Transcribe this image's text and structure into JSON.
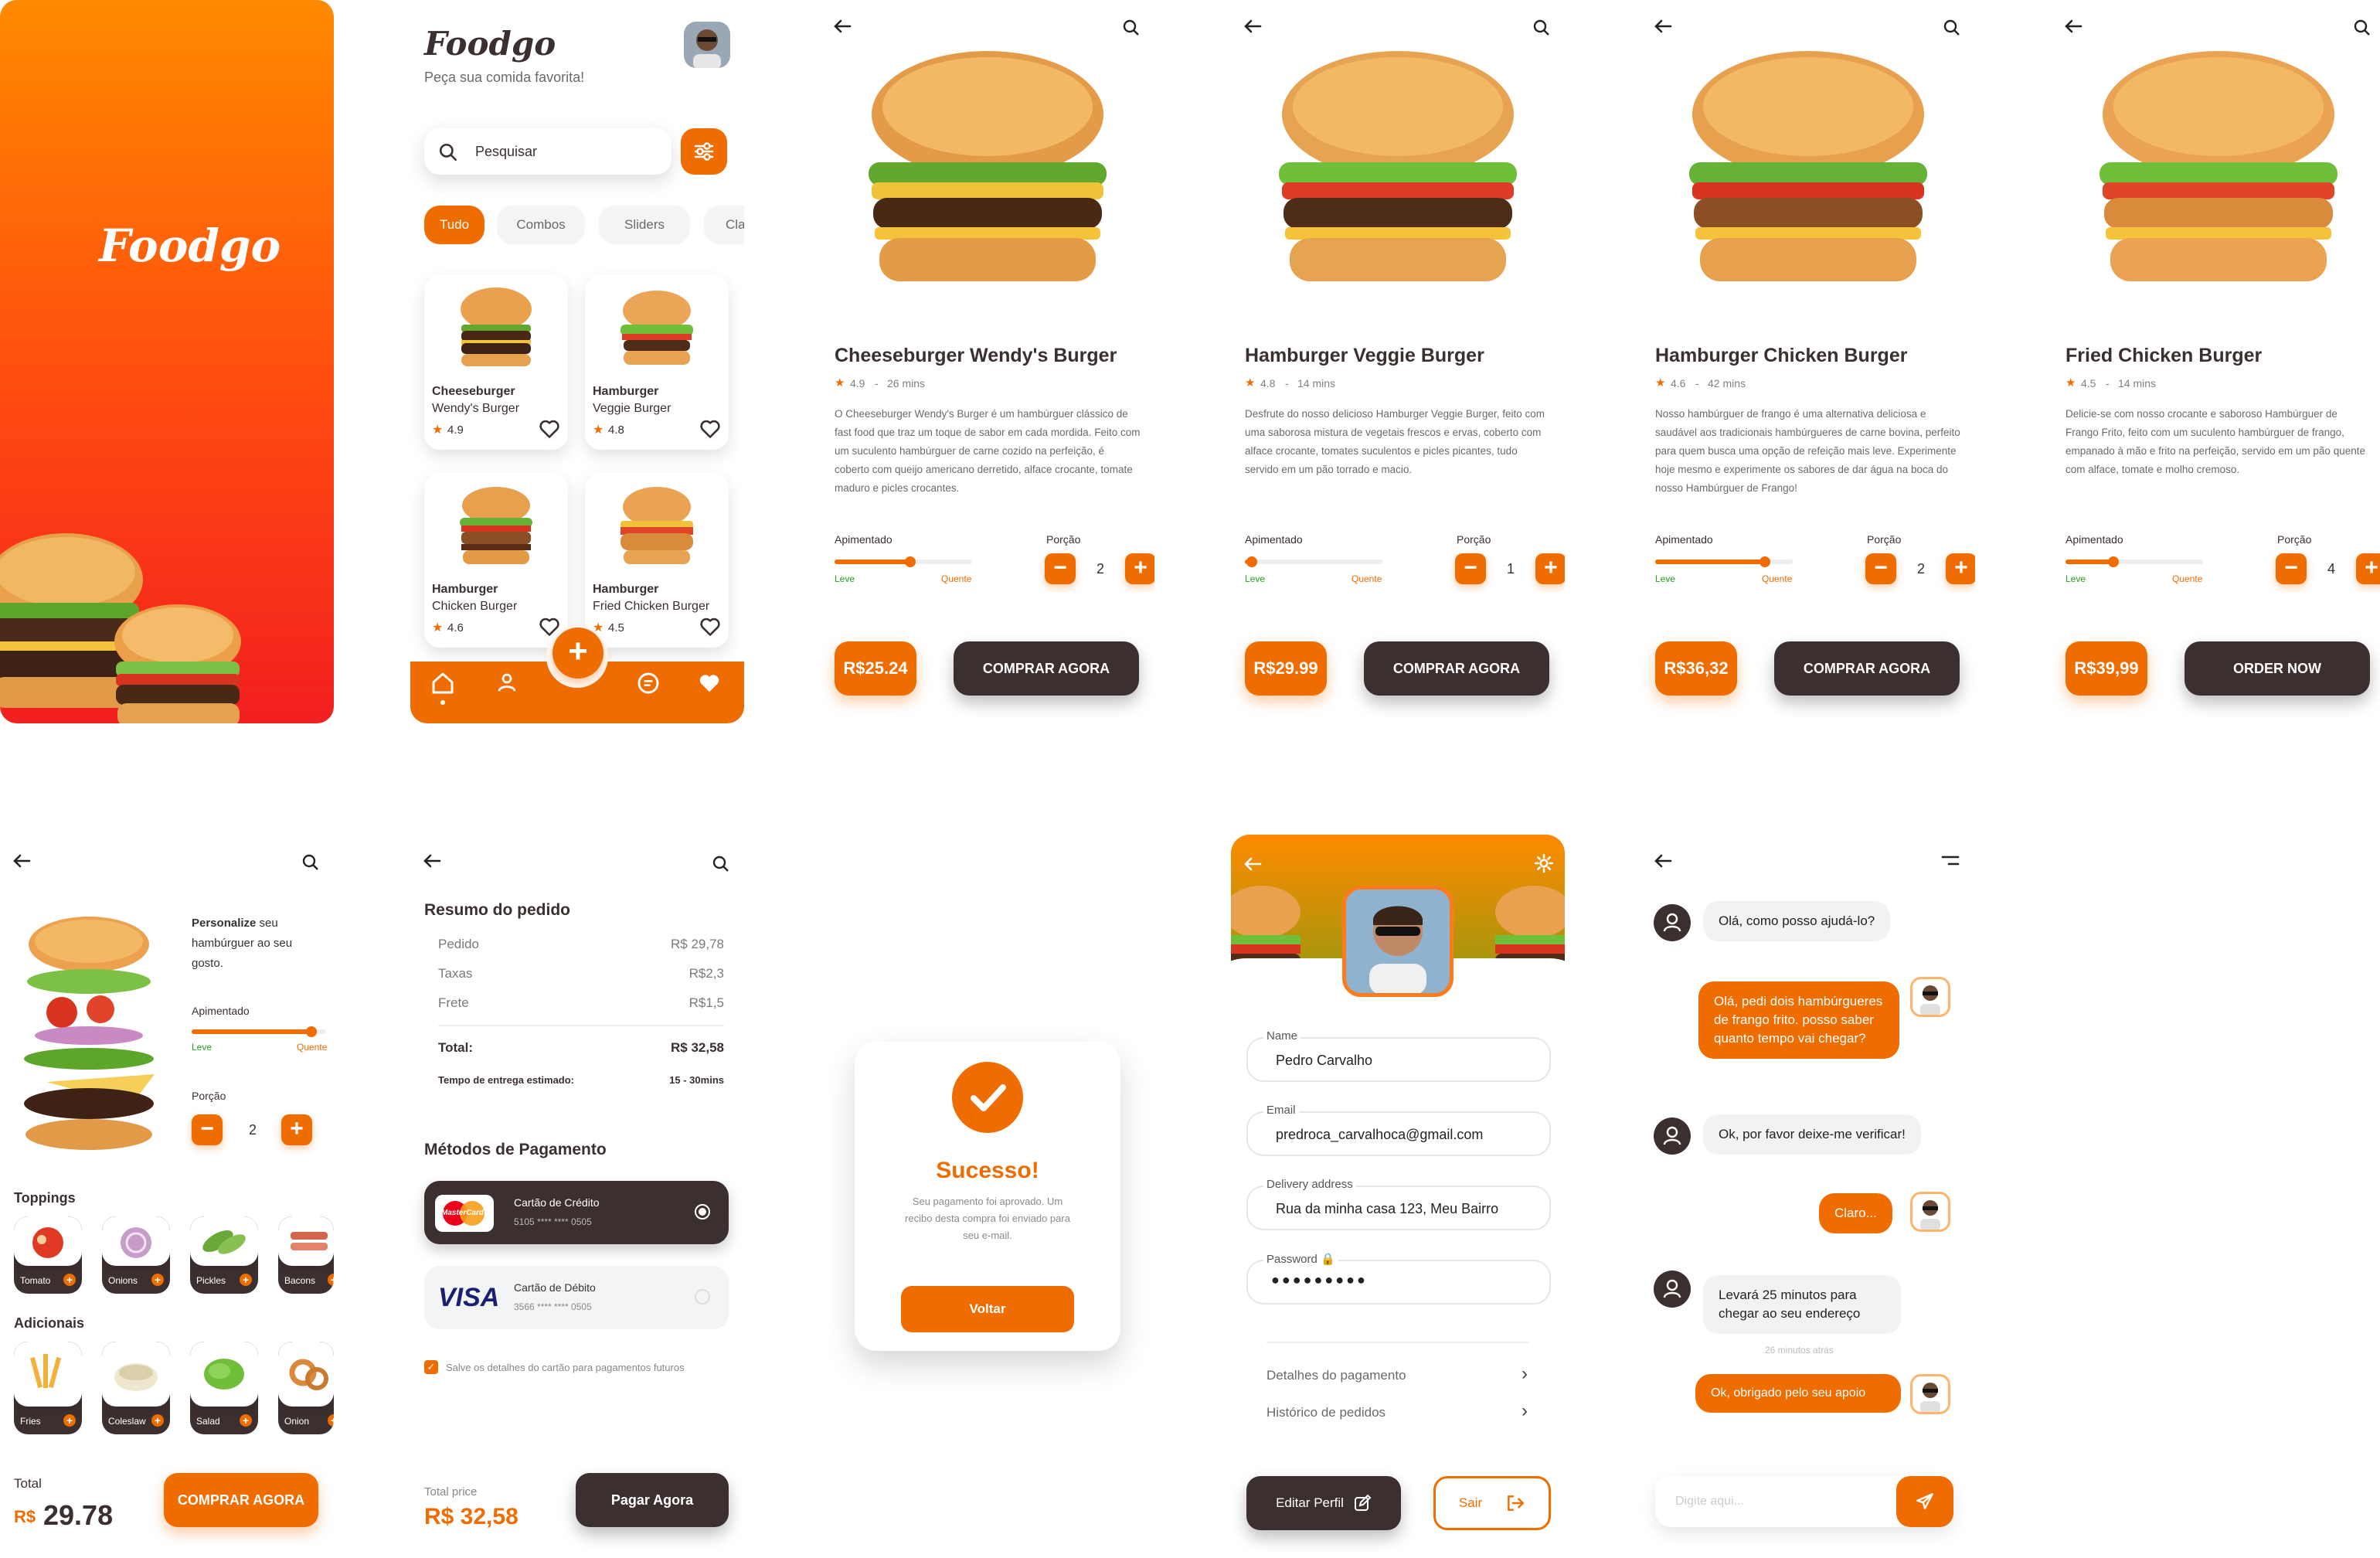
{
  "brand": {
    "name": "Foodgo",
    "tagline": "Peça sua comida favorita!"
  },
  "colors": {
    "accent": "#ef6c00",
    "dark": "#3c2f2f",
    "muted": "#808080"
  },
  "home": {
    "search_placeholder": "Pesquisar",
    "chips": [
      "Tudo",
      "Combos",
      "Sliders",
      "Cla"
    ],
    "products": [
      {
        "line1": "Cheeseburger",
        "line2": "Wendy's Burger",
        "rating": "4.9"
      },
      {
        "line1": "Hamburger",
        "line2": "Veggie Burger",
        "rating": "4.8"
      },
      {
        "line1": "Hamburger",
        "line2": "Chicken Burger",
        "rating": "4.6"
      },
      {
        "line1": "Hamburger",
        "line2": "Fried Chicken Burger",
        "rating": "4.5"
      }
    ],
    "nav_icons": [
      "home-icon",
      "user-icon",
      "add-icon",
      "chat-icon",
      "heart-icon"
    ]
  },
  "details": [
    {
      "title": "Cheeseburger Wendy's Burger",
      "rating": "4.9",
      "time": "26 mins",
      "desc": "O Cheeseburger Wendy's Burger é um hambúrguer clássico de fast food que traz um toque de sabor em cada mordida. Feito com um suculento hambúrguer de carne cozido na perfeição, é coberto com queijo americano derretido, alface crocante, tomate maduro e picles crocantes.",
      "spicy_label": "Apimentado",
      "low": "Leve",
      "high": "Quente",
      "spicy_value": 0.55,
      "portion_label": "Porção",
      "portion": "2",
      "price": "R$25.24",
      "cta": "COMPRAR AGORA"
    },
    {
      "title": "Hamburger Veggie Burger",
      "rating": "4.8",
      "time": "14 mins",
      "desc": "Desfrute do nosso delicioso Hamburger Veggie Burger, feito com uma saborosa mistura de vegetais frescos e ervas, coberto com alface crocante, tomates suculentos e picles picantes, tudo servido em um pão torrado e macio.",
      "spicy_label": "Apimentado",
      "low": "Leve",
      "high": "Quente",
      "spicy_value": 0.05,
      "portion_label": "Porção",
      "portion": "1",
      "price": "R$29.99",
      "cta": "COMPRAR AGORA"
    },
    {
      "title": "Hamburger Chicken Burger",
      "rating": "4.6",
      "time": "42 mins",
      "desc": "Nosso hambúrguer de frango é uma alternativa deliciosa e saudável aos tradicionais hambúrgueres de carne bovina, perfeito para quem busca uma opção de refeição mais leve. Experimente hoje mesmo e experimente os sabores de dar água na boca do nosso Hambúrguer de Frango!",
      "spicy_label": "Apimentado",
      "low": "Leve",
      "high": "Quente",
      "spicy_value": 0.8,
      "portion_label": "Porção",
      "portion": "2",
      "price": "R$36,32",
      "cta": "COMPRAR AGORA"
    },
    {
      "title": "Fried Chicken Burger",
      "rating": "4.5",
      "time": "14 mins",
      "desc": "Delicie-se com nosso crocante e saboroso Hambúrguer de Frango Frito, feito com um suculento hambúrguer de frango, empanado à mão e frito na perfeição, servido em um pão quente com alface, tomate e molho cremoso.",
      "spicy_label": "Apimentado",
      "low": "Leve",
      "high": "Quente",
      "spicy_value": 0.35,
      "portion_label": "Porção",
      "portion": "4",
      "price": "R$39,99",
      "cta": "ORDER NOW"
    }
  ],
  "customize": {
    "intro_bold": "Personalize",
    "intro_rest": " seu hambúrguer ao seu gosto.",
    "spicy_label": "Apimentado",
    "low": "Leve",
    "high": "Quente",
    "spicy_value": 0.9,
    "portion_label": "Porção",
    "portion": "2",
    "toppings_title": "Toppings",
    "toppings": [
      "Tomato",
      "Onions",
      "Pickles",
      "Bacons"
    ],
    "sides_title": "Adicionais",
    "sides": [
      "Fries",
      "Coleslaw",
      "Salad",
      "Onion"
    ],
    "total_label": "Total",
    "currency": "R$",
    "total": "29.78",
    "cta": "COMPRAR AGORA"
  },
  "payment": {
    "summary_title": "Resumo do pedido",
    "rows": [
      {
        "label": "Pedido",
        "value": "R$ 29,78"
      },
      {
        "label": "Taxas",
        "value": "R$2,3"
      },
      {
        "label": "Frete",
        "value": "R$1,5"
      }
    ],
    "total_label": "Total:",
    "total_value": "R$ 32,58",
    "eta_label": "Tempo de entrega estimado:",
    "eta_value": "15 - 30mins",
    "methods_title": "Métodos de Pagamento",
    "cards": [
      {
        "brand": "MasterCard",
        "name": "Cartão de Crédito",
        "number": "5105 **** **** 0505"
      },
      {
        "brand": "VISA",
        "name": "Cartão de Débito",
        "number": "3566 **** **** 0505"
      }
    ],
    "save_label": "Salve os detalhes do cartão para pagamentos futuros",
    "total_price_label": "Total price",
    "total_price": "R$ 32,58",
    "cta": "Pagar Agora"
  },
  "success": {
    "title": "Sucesso!",
    "message": "Seu pagamento foi aprovado. Um recibo desta compra foi enviado para seu e-mail.",
    "cta": "Voltar"
  },
  "profile": {
    "fields": [
      {
        "label": "Name",
        "value": "Pedro Carvalho"
      },
      {
        "label": "Email",
        "value": "predroca_carvalhoca@gmail.com"
      },
      {
        "label": "Delivery address",
        "value": "Rua da minha casa 123, Meu Bairro"
      },
      {
        "label": "Password",
        "value": "●●●●●●●●●"
      }
    ],
    "links": [
      "Detalhes do pagamento",
      "Histórico de pedidos"
    ],
    "edit": "Editar Perfil",
    "logout": "Sair"
  },
  "chat": {
    "messages": [
      {
        "from": "support",
        "text": "Olá, como posso ajudá-lo?"
      },
      {
        "from": "user",
        "text": "Olá, pedi dois hambúrgueres de frango frito. posso saber quanto tempo vai chegar?"
      },
      {
        "from": "support",
        "text": "Ok, por favor deixe-me verificar!"
      },
      {
        "from": "user",
        "text": "Claro..."
      },
      {
        "from": "support",
        "text": "Levará 25 minutos para chegar ao seu endereço"
      },
      {
        "from": "user",
        "text": "Ok, obrigado pelo seu apoio"
      }
    ],
    "timestamp": "26 minutos atrás",
    "placeholder": "Digite aqui..."
  }
}
